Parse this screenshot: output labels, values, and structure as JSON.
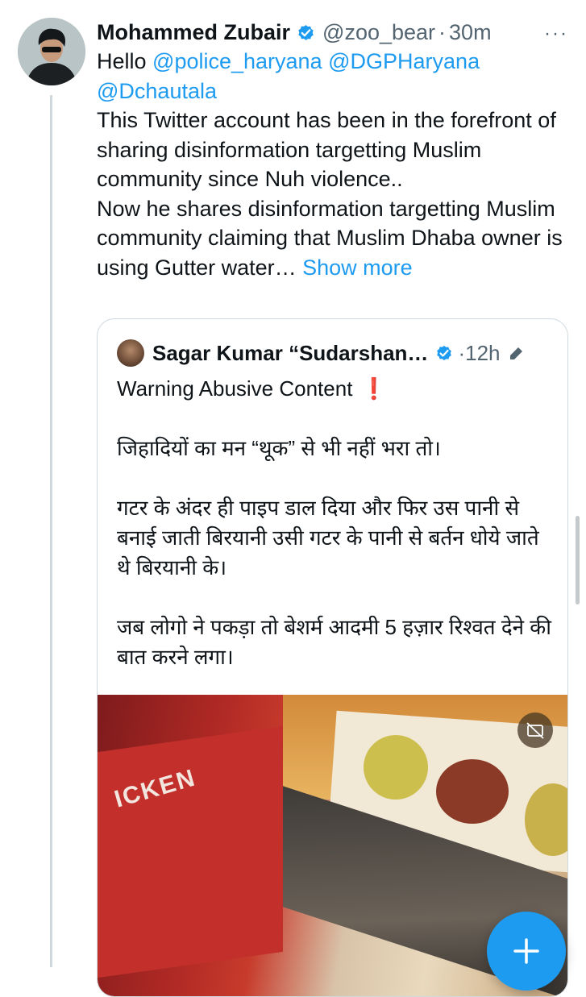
{
  "tweet": {
    "author_name": "Mohammed Zubair",
    "handle": "@zoo_bear",
    "separator": "·",
    "time": "30m",
    "more_menu": "···",
    "greeting": "Hello",
    "mentions": [
      "@police_haryana",
      "@DGPHaryana",
      "@Dchautala"
    ],
    "line1": "This Twitter account has been in the forefront of sharing disinformation targetting Muslim community since Nuh violence..",
    "line2": "Now he shares disinformation targetting Muslim community claiming that Muslim Dhaba owner is using Gutter water…",
    "show_more": "Show more"
  },
  "quote": {
    "author_name": "Sagar Kumar “Sudarshan…",
    "separator": "·",
    "time": "12h",
    "warning_line": "Warning Abusive Content",
    "warning_emoji": "❗",
    "para1": "जिहादियों का मन “थूक” से भी नहीं भरा तो।",
    "para2": "गटर के अंदर ही पाइप डाल दिया और फिर उस पानी से बनाई जाती बिरयानी उसी गटर के पानी से बर्तन धोये जाते थे बिरयानी के।",
    "para3": "जब लोगो ने पकड़ा तो बेशर्म आदमी 5 हज़ार रिश्वत देने की बात करने लगा।",
    "media_sign_text": "ICKEN"
  },
  "icons": {
    "verified": "verified-badge-icon",
    "edit": "pen-icon",
    "captions": "captions-icon",
    "compose": "plus-icon"
  },
  "colors": {
    "accent": "#1d9bf0",
    "text": "#0f1419",
    "secondary": "#536471",
    "border": "#cfd9de"
  }
}
